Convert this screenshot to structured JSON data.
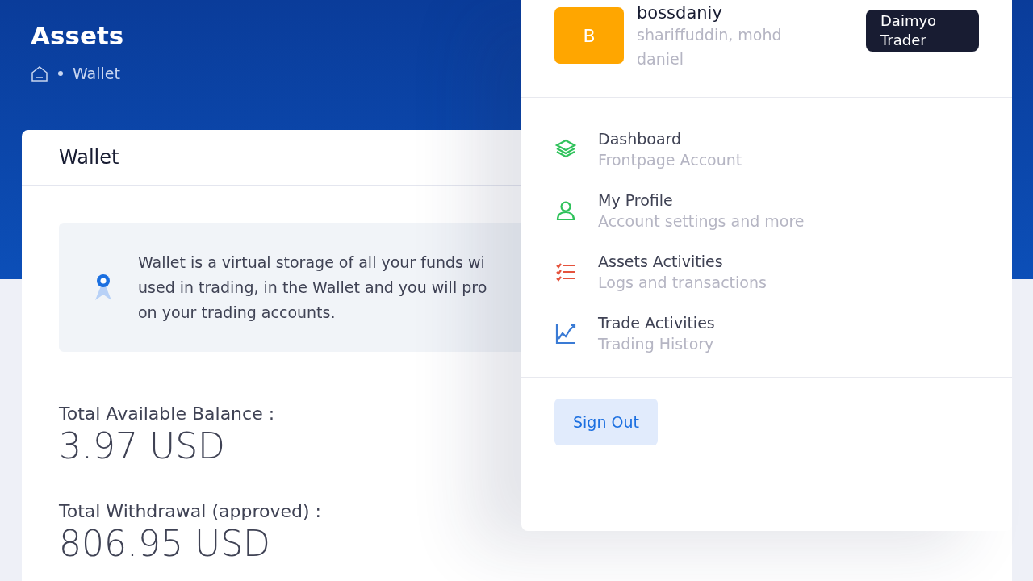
{
  "page_title": "Assets",
  "breadcrumb": {
    "items": [
      "Wallet"
    ]
  },
  "wallet_card": {
    "title": "Wallet",
    "info_lines": [
      "Wallet is a virtual storage of all your funds wi",
      "used in trading, in the Wallet and you will pro",
      "on your trading accounts."
    ],
    "stats": [
      {
        "label": "Total Available Balance :",
        "value": "3.97 USD"
      },
      {
        "label": "Total Withdrawal (approved) :",
        "value": "806.95 USD"
      }
    ]
  },
  "user_menu": {
    "avatar": {
      "initial": "B",
      "color": "#ffa600"
    },
    "username": "bossdaniy",
    "full_name": "shariffuddin, mohd daniel",
    "badge": "Daimyo Trader",
    "items": [
      {
        "title": "Dashboard",
        "subtitle": "Frontpage Account",
        "color": "#2fc25b"
      },
      {
        "title": "My Profile",
        "subtitle": "Account settings and more",
        "color": "#2fc25b"
      },
      {
        "title": "Assets Activities",
        "subtitle": "Logs and transactions",
        "color": "#e5533d"
      },
      {
        "title": "Trade Activities",
        "subtitle": "Trading History",
        "color": "#3a7bd5"
      }
    ],
    "sign_out": "Sign Out"
  }
}
